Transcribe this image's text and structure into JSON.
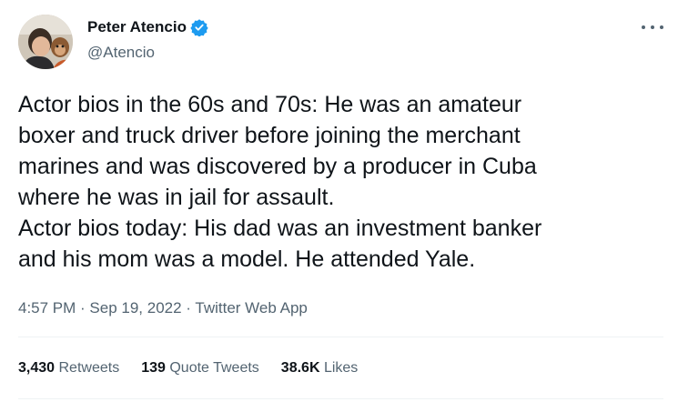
{
  "author": {
    "display_name": "Peter Atencio",
    "handle": "@Atencio",
    "verified": true,
    "avatar_icon": "avatar-photo"
  },
  "tweet": {
    "lines": [
      "Actor bios in the 60s and 70s: He was an amateur",
      "boxer and truck driver before joining the merchant",
      "marines and was discovered by a producer in Cuba",
      "where he was in jail for assault.",
      "Actor bios today: His dad was an investment banker",
      "and his mom was a model. He attended Yale."
    ],
    "time": "4:57 PM",
    "date": "Sep 19, 2022",
    "source": "Twitter Web App",
    "separator": " · "
  },
  "stats": [
    {
      "count": "3,430",
      "label": "Retweets"
    },
    {
      "count": "139",
      "label": "Quote Tweets"
    },
    {
      "count": "38.6K",
      "label": "Likes"
    }
  ],
  "colors": {
    "text": "#0f1419",
    "secondary": "#536471",
    "verified": "#1d9bf0",
    "divider": "#eff3f4"
  }
}
